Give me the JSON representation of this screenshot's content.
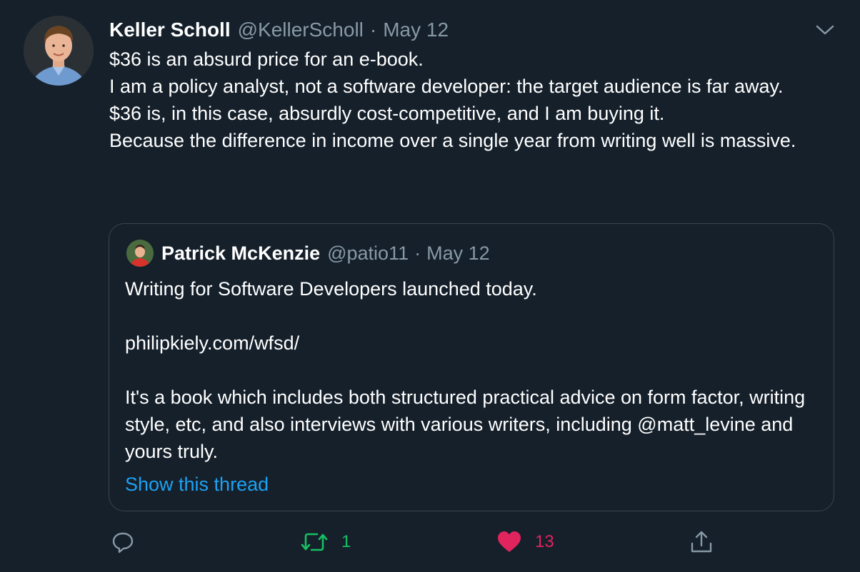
{
  "tweet": {
    "display_name": "Keller Scholl",
    "handle": "@KellerScholl",
    "separator": "·",
    "date": "May 12",
    "lines": [
      "$36 is an absurd price for an e-book.",
      "I am a policy analyst, not a software developer: the target audience is far away.",
      "$36 is, in this case, absurdly cost-competitive, and I am buying it.",
      "Because the difference in income over a single year from writing well is massive."
    ],
    "icons": {
      "avatar": "avatar",
      "menu": "chevron-down-icon"
    }
  },
  "quoted_tweet": {
    "display_name": "Patrick McKenzie",
    "handle": "@patio11",
    "separator": "·",
    "date": "May 12",
    "line1": "Writing for Software Developers launched today.",
    "link": "philipkiely.com/wfsd/",
    "line3": "It's a book which includes both structured practical advice on form factor, writing style, etc, and also interviews with various writers, including @matt_levine and yours truly.",
    "show_thread": "Show this thread"
  },
  "actions": {
    "reply_count": "",
    "retweet_count": "1",
    "like_count": "13",
    "icons": [
      "reply-icon",
      "retweet-icon",
      "like-icon",
      "share-icon"
    ]
  },
  "colors": {
    "background": "#15202b",
    "text": "#ffffff",
    "secondary": "#8899a6",
    "border": "#38444d",
    "link": "#1da1f2",
    "retweet": "#17bf63",
    "like": "#e0245e"
  }
}
